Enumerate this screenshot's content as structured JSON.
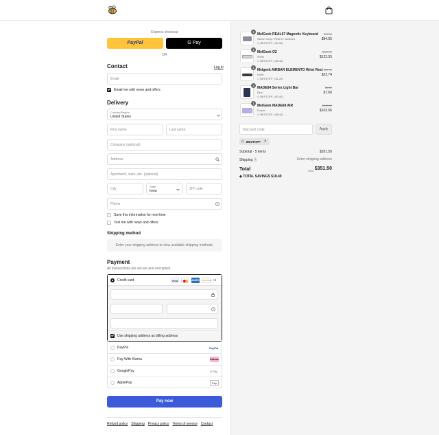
{
  "header": {
    "logo_icon": "bee-logo-icon",
    "cart_icon": "shopping-bag-icon"
  },
  "express": {
    "label": "Express checkout",
    "paypal_label": "PayPal",
    "gpay_label": "G Pay",
    "or_label": "OR"
  },
  "contact": {
    "heading": "Contact",
    "login_link": "Log in",
    "email_placeholder": "Email",
    "email_news_label": "Email me with news and offers",
    "email_news_checked": true
  },
  "delivery": {
    "heading": "Delivery",
    "country_label": "Country/Region",
    "country_value": "United States",
    "first_name_placeholder": "First name",
    "last_name_placeholder": "Last name",
    "company_placeholder": "Company (optional)",
    "address_placeholder": "Address",
    "apartment_placeholder": "Apartment, suite, etc. (optional)",
    "city_placeholder": "City",
    "state_label": "State",
    "state_value": "Iowa",
    "zip_placeholder": "ZIP code",
    "phone_placeholder": "Phone",
    "save_info_label": "Save this information for next time",
    "text_news_label": "Text me with news and offers"
  },
  "shipping": {
    "heading": "Shipping method",
    "notice": "Enter your shipping address to view available shipping methods."
  },
  "payment": {
    "heading": "Payment",
    "subtext": "All transactions are secure and encrypted.",
    "credit_card_label": "Credit card",
    "card_badges": [
      "VISA",
      "MC",
      "AMEX",
      "DISCOVER"
    ],
    "more_cards": "+2",
    "billing_label": "Use shipping address as billing address",
    "options": [
      {
        "label": "PayPal",
        "badge": "PayPal"
      },
      {
        "label": "Pay With Klarna",
        "badge": "Klarna."
      },
      {
        "label": "GooglePay",
        "badge": "G Pay"
      },
      {
        "label": "ApplePay",
        "badge": "Pay"
      }
    ],
    "pay_button": "Pay now"
  },
  "footer_links": [
    "Refund policy",
    "Shipping",
    "Privacy policy",
    "Terms of service",
    "Contact"
  ],
  "order": {
    "items": [
      {
        "qty": "1",
        "name": "MelGeek REAL67 Magnetic Keyboard",
        "variant": "Silicon Gray / Real 67 switches",
        "discount": "BESTOFF (-$4.96)",
        "old_price": "$99.01",
        "price": "$94.05"
      },
      {
        "qty": "1",
        "name": "MelGeek O2",
        "variant": "White",
        "discount": "BESTOFF (-$6.45)",
        "old_price": "$129.00",
        "price": "$122.55"
      },
      {
        "qty": "1",
        "name": "Melgeek AIRBAR ELEMENTO Wrist Rest",
        "variant": "Earth",
        "discount": "BESTOFF (-$1.25)",
        "old_price": "$24.99",
        "price": "$23.74"
      },
      {
        "qty": "1",
        "name": "MADE84 Series Light Bar",
        "variant": "Blue",
        "discount": "BESTOFF (-$0.40)",
        "old_price": "$8.00",
        "price": "$7.60"
      },
      {
        "qty": "1",
        "name": "MelGeek MADE68 AIR",
        "variant": "Purple",
        "discount": "BESTOFF (-$8.44)",
        "old_price": "$168.00",
        "price": "$103.56"
      }
    ],
    "discount_placeholder": "Discount code",
    "apply_label": "Apply",
    "applied_code": "BESTOFF",
    "subtotal_label": "Subtotal · 5 items",
    "subtotal_value": "$351.50",
    "shipping_label": "Shipping",
    "shipping_value": "Enter shipping address",
    "total_label": "Total",
    "currency": "USD",
    "total_value": "$351.50",
    "savings_label": "TOTAL SAVINGS",
    "savings_value": "$18.49"
  }
}
